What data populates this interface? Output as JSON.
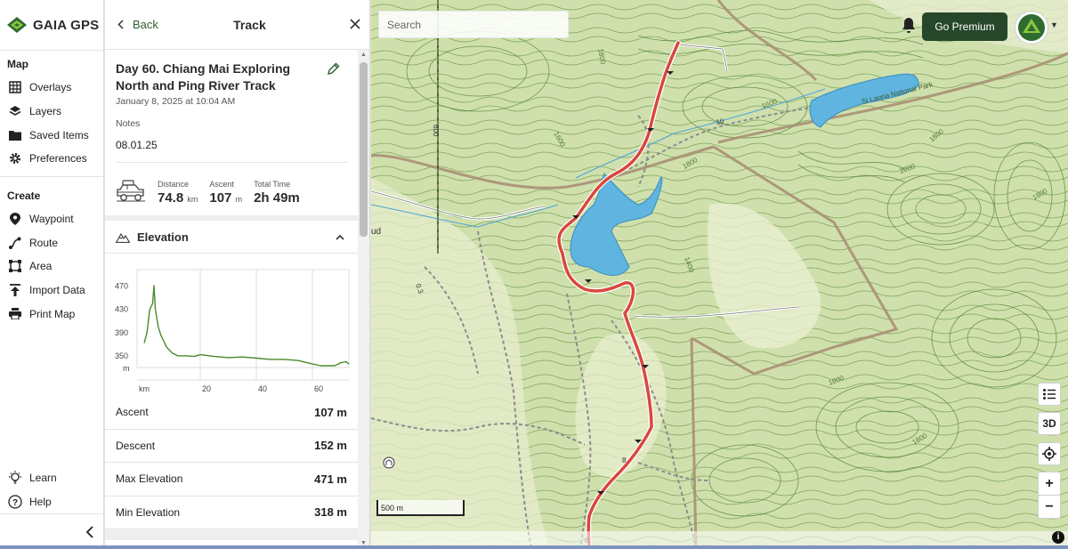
{
  "brand": {
    "name": "GAIA GPS"
  },
  "nav": {
    "map_title": "Map",
    "map_items": [
      {
        "label": "Overlays",
        "icon": "overlays-icon"
      },
      {
        "label": "Layers",
        "icon": "layers-icon"
      },
      {
        "label": "Saved Items",
        "icon": "folder-icon"
      },
      {
        "label": "Preferences",
        "icon": "gear-icon"
      }
    ],
    "create_title": "Create",
    "create_items": [
      {
        "label": "Waypoint",
        "icon": "pin-icon"
      },
      {
        "label": "Route",
        "icon": "route-icon"
      },
      {
        "label": "Area",
        "icon": "area-icon"
      },
      {
        "label": "Import Data",
        "icon": "upload-icon"
      },
      {
        "label": "Print Map",
        "icon": "printer-icon"
      }
    ],
    "bottom_items": [
      {
        "label": "Learn",
        "icon": "lightbulb-icon"
      },
      {
        "label": "Help",
        "icon": "help-icon"
      }
    ]
  },
  "panel": {
    "back_label": "Back",
    "title": "Track",
    "track_title": "Day 60. Chiang Mai Exploring North and Ping River Track",
    "track_date": "January 8, 2025 at 10:04 AM",
    "notes_label": "Notes",
    "notes_value": "08.01.25",
    "distance_label": "Distance",
    "distance_value": "74.8",
    "distance_unit": "km",
    "ascent_label": "Ascent",
    "ascent_value": "107",
    "ascent_unit": "m",
    "time_label": "Total Time",
    "time_value": "2h 49m",
    "elevation_title": "Elevation",
    "stats": [
      {
        "label": "Ascent",
        "value": "107 m"
      },
      {
        "label": "Descent",
        "value": "152 m"
      },
      {
        "label": "Max Elevation",
        "value": "471 m"
      },
      {
        "label": "Min Elevation",
        "value": "318 m"
      }
    ]
  },
  "chart_data": {
    "type": "line",
    "ylabel": "m",
    "xlabel": "km",
    "y_ticks": [
      "470",
      "430",
      "390",
      "350"
    ],
    "x_ticks": [
      "20",
      "40",
      "60"
    ],
    "ylim": [
      330,
      480
    ],
    "xlim": [
      0,
      73
    ],
    "x": [
      0,
      1,
      2,
      3,
      3.5,
      4,
      5,
      6,
      7,
      8,
      10,
      12,
      15,
      18,
      20,
      25,
      30,
      35,
      40,
      45,
      50,
      55,
      60,
      63,
      65,
      68,
      70,
      72,
      73
    ],
    "values": [
      372,
      390,
      430,
      440,
      471,
      430,
      400,
      385,
      375,
      365,
      355,
      350,
      350,
      349,
      352,
      349,
      347,
      348,
      346,
      344,
      344,
      342,
      336,
      333,
      333,
      333,
      338,
      340,
      336
    ],
    "color": "#4a8a2a"
  },
  "map": {
    "search_placeholder": "Search",
    "premium_label": "Go Premium",
    "scale_label": "500 m",
    "btn_3d": "3D",
    "btn_zoom_in": "+",
    "btn_zoom_out": "−",
    "info": "i",
    "labels": {
      "park": "Si Lanna National Park",
      "c1800a": "1800",
      "c1800b": "1800",
      "c1600a": "1600",
      "c1600b": "1600",
      "c2000": "2000",
      "c1800c": "1800",
      "c1800d": "1800",
      "c1400": "1400",
      "c1600c": "1600",
      "c1800e": "1800",
      "r10": "10",
      "r600": "600",
      "r8": "8",
      "r6": "6",
      "r03": "0.3",
      "rud": "ud"
    },
    "colors": {
      "water": "#5fb4e0",
      "track": "#d9473b",
      "contour": "#4d7a2f"
    }
  }
}
